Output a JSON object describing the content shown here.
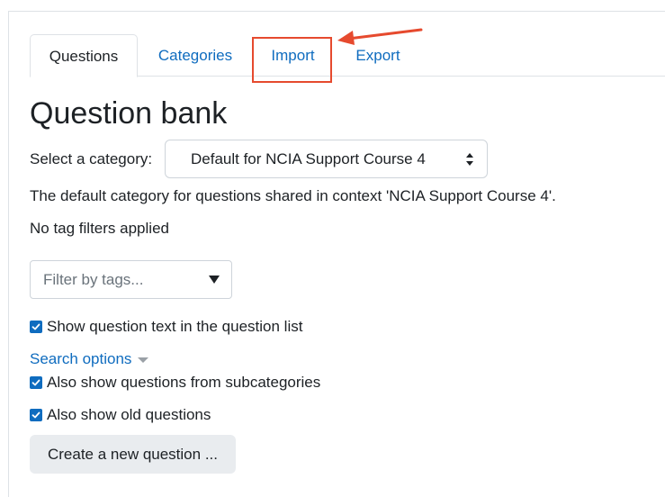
{
  "colors": {
    "link": "#0f6cbf",
    "text": "#1d2125",
    "border": "#dee2e6",
    "annotation": "#e64a2e",
    "button_bg": "#e9ecef",
    "checkbox": "#0f6cbf"
  },
  "tabs": [
    {
      "label": "Questions",
      "active": true
    },
    {
      "label": "Categories",
      "active": false
    },
    {
      "label": "Import",
      "active": false,
      "highlighted": true
    },
    {
      "label": "Export",
      "active": false
    }
  ],
  "page_title": "Question bank",
  "category": {
    "label": "Select a category:",
    "selected": "Default for NCIA Support Course 4",
    "icon": "sort-icon"
  },
  "context_description": "The default category for questions shared in context 'NCIA Support Course 4'.",
  "tag_status": "No tag filters applied",
  "tag_filter": {
    "placeholder": "Filter by tags...",
    "icon": "dropdown-triangle-icon"
  },
  "options": {
    "show_question_text": {
      "label": "Show question text in the question list",
      "checked": true
    },
    "search_options_label": "Search options",
    "subcategories": {
      "label": "Also show questions from subcategories",
      "checked": true
    },
    "old_questions": {
      "label": "Also show old questions",
      "checked": true
    }
  },
  "create_button_label": "Create a new question ...",
  "annotation": {
    "type": "arrow",
    "target": "Import"
  }
}
